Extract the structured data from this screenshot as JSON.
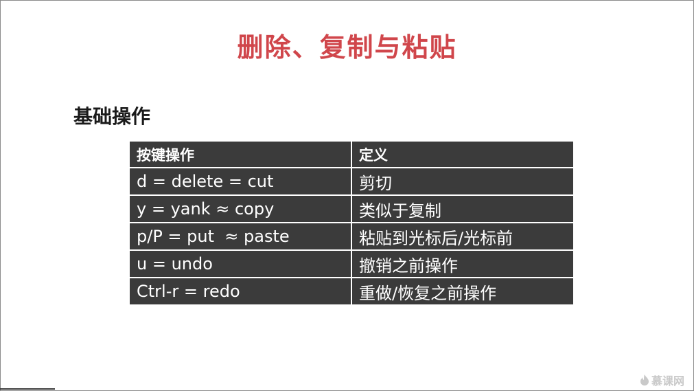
{
  "slide": {
    "title": "删除、复制与粘贴",
    "section_heading": "基础操作"
  },
  "table": {
    "headers": [
      "按键操作",
      "定义"
    ],
    "rows": [
      [
        "d = delete = cut",
        "剪切"
      ],
      [
        "y = yank ≈ copy",
        "类似于复制"
      ],
      [
        "p/P = put  ≈ paste",
        "粘贴到光标后/光标前"
      ],
      [
        "u = undo",
        "撤销之前操作"
      ],
      [
        "Ctrl-r = redo",
        "重做/恢复之前操作"
      ]
    ]
  },
  "watermark": {
    "text": "慕课网",
    "icon": "flame-logo-icon"
  },
  "colors": {
    "title": "#d0464b",
    "table_bg": "#3b3b3b",
    "table_text": "#ffffff"
  }
}
